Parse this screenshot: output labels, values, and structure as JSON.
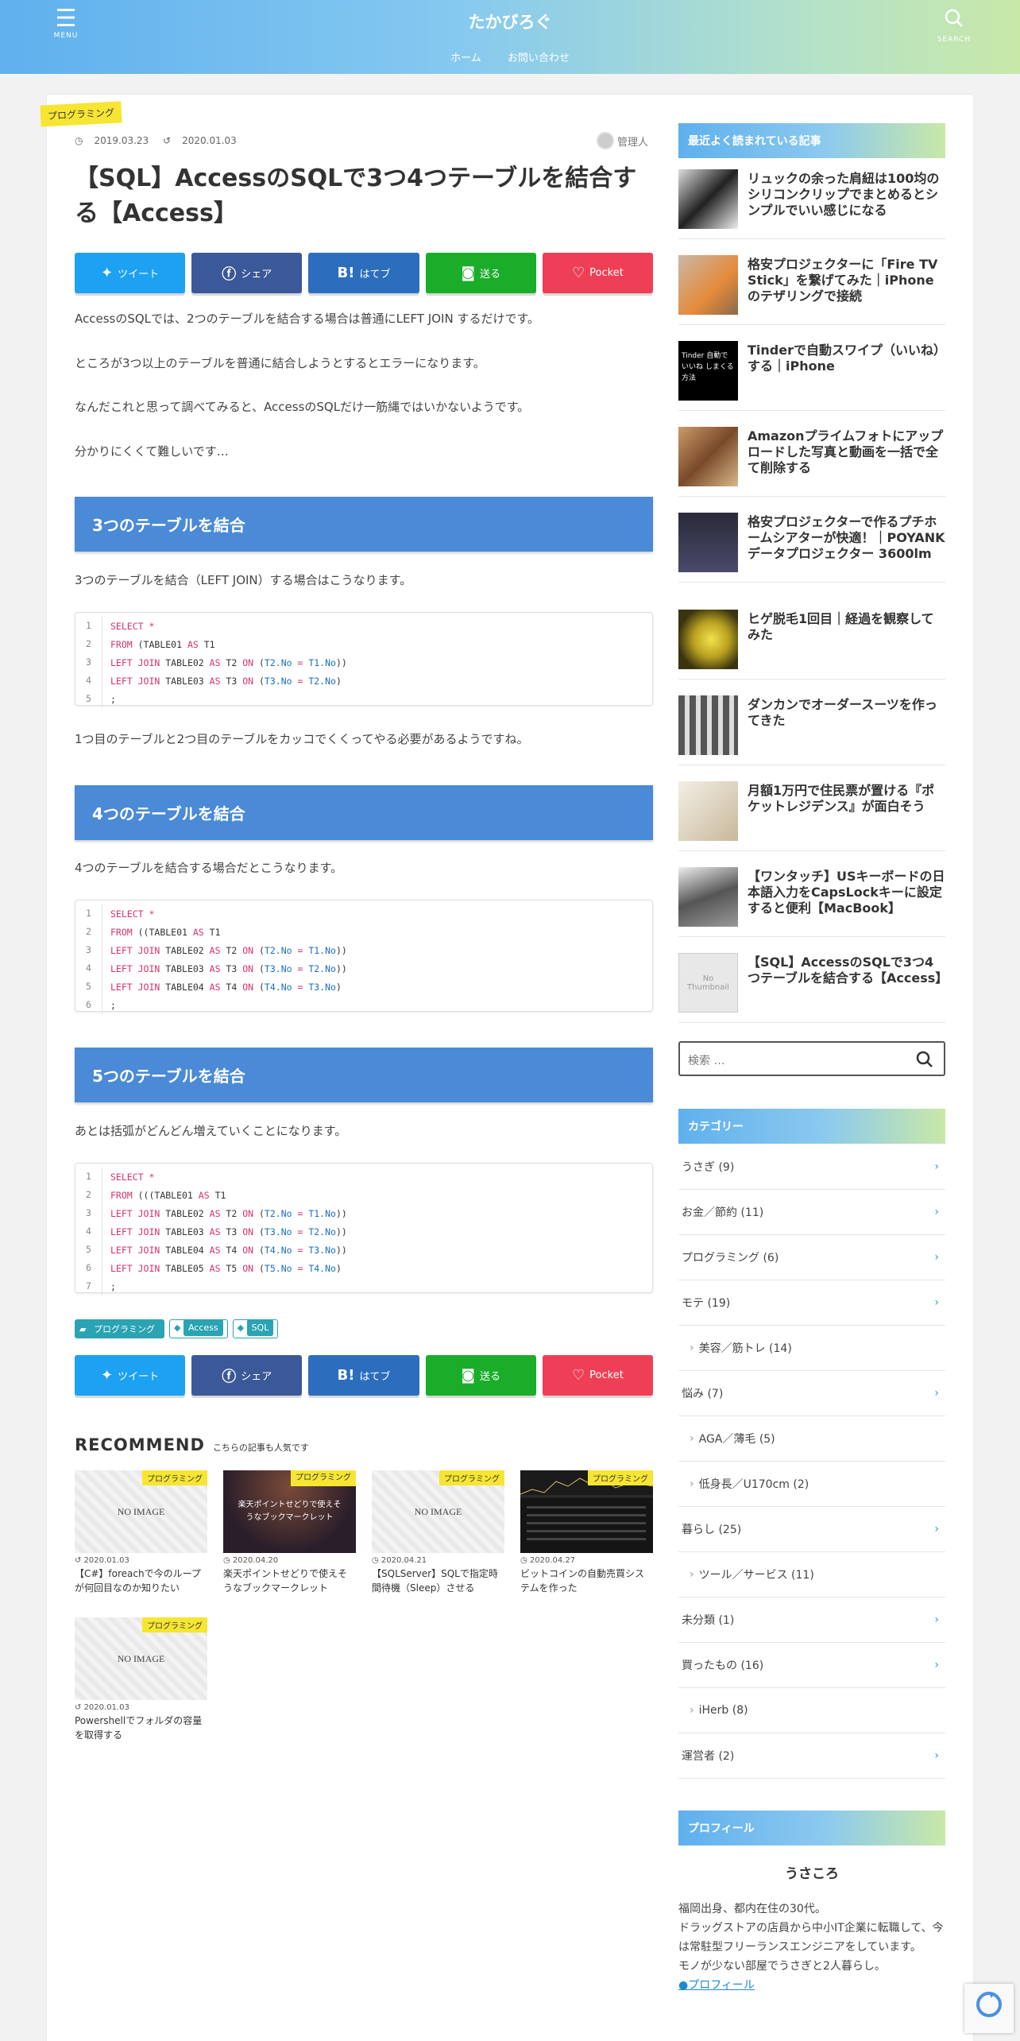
{
  "header": {
    "menu_label": "MENU",
    "search_label": "SEARCH",
    "site_title": "たかびろぐ",
    "nav": [
      "ホーム",
      "お問い合わせ"
    ]
  },
  "article": {
    "category": "プログラミング",
    "published": "2019.03.23",
    "updated": "2020.01.03",
    "author": "管理人",
    "title": "【SQL】AccessのSQLで3つ4つテーブルを結合する【Access】",
    "share": [
      "ツイート",
      "シェア",
      "はてブ",
      "送る",
      "Pocket"
    ],
    "intro": [
      "AccessのSQLでは、2つのテーブルを結合する場合は普通にLEFT JOIN するだけです。",
      "ところが3つ以上のテーブルを普通に結合しようとするとエラーになります。",
      "なんだこれと思って調べてみると、AccessのSQLだけ一筋縄ではいかないようです。",
      "分かりにくくて難しいです…"
    ],
    "sec1_title": "3つのテーブルを結合",
    "sec1_text": "3つのテーブルを結合（LEFT JOIN）する場合はこうなります。",
    "sec1_after": "1つ目のテーブルと2つ目のテーブルをカッコでくくってやる必要があるようですね。",
    "sec2_title": "4つのテーブルを結合",
    "sec2_text": "4つのテーブルを結合する場合だとこうなります。",
    "sec3_title": "5つのテーブルを結合",
    "sec3_text": "あとは括弧がどんどん増えていくことになります。",
    "tags": [
      "プログラミング",
      "Access",
      "SQL"
    ]
  },
  "recommend": {
    "title": "RECOMMEND",
    "sub": "こちらの記事も人気です",
    "no_image": "NO IMAGE",
    "thumb2_text": "楽天ポイントせどりで使えそうなブックマークレット",
    "items": [
      {
        "cat": "プログラミング",
        "date": "2020.01.03",
        "title": "【C#】foreachで今のループが何回目なのか知りたい"
      },
      {
        "cat": "プログラミング",
        "date": "2020.04.20",
        "title": "楽天ポイントせどりで使えそうなブックマークレット"
      },
      {
        "cat": "プログラミング",
        "date": "2020.04.21",
        "title": "【SQLServer】SQLで指定時間待機（Sleep）させる"
      },
      {
        "cat": "プログラミング",
        "date": "2020.04.27",
        "title": "ビットコインの自動売買システムを作った"
      },
      {
        "cat": "プログラミング",
        "date": "2020.01.03",
        "title": "Powershellでフォルダの容量を取得する"
      }
    ]
  },
  "sidebar": {
    "popular_title": "最近よく読まれている記事",
    "popular": [
      "リュックの余った肩紐は100均のシリコンクリップでまとめるとシンプルでいい感じになる",
      "格安プロジェクターに「Fire TV Stick」を繋げてみた｜iPhoneのテザリングで接続",
      "Tinderで自動スワイプ（いいね）する｜iPhone",
      "Amazonプライムフォトにアップロードした写真と動画を一括で全て削除する",
      "格安プロジェクターで作るプチホームシアターが快適！｜POYANK データプロジェクター 3600lm",
      "ヒゲ脱毛1回目｜経過を観察してみた",
      "ダンカンでオーダースーツを作ってきた",
      "月額1万円で住民票が置ける『ポケットレジデンス』が面白そう",
      "【ワンタッチ】USキーボードの日本語入力をCapsLockキーに設定すると便利【MacBook】",
      "【SQL】AccessのSQLで3つ4つテーブルを結合する【Access】"
    ],
    "no_thumb": "No Thumbnail",
    "tinder_text": "Tinder 自動でいいね しまくる方法",
    "search_placeholder": "検索 …",
    "category_title": "カテゴリー",
    "categories": [
      "うさぎ (9)",
      "お金／節約 (11)",
      "プログラミング (6)",
      "モテ (19)",
      "美容／筋トレ (14)",
      "悩み (7)",
      "AGA／薄毛 (5)",
      "低身長／U170cm (2)",
      "暮らし (25)",
      "ツール／サービス (11)",
      "未分類 (1)",
      "買ったもの (16)",
      "iHerb (8)",
      "運営者 (2)"
    ],
    "profile_title": "プロフィール",
    "profile_name": "うさころ",
    "profile_lines": [
      "福岡出身、都内在住の30代。",
      "ドラッグストアの店員から中小IT企業に転職して、今は常駐型フリーランスエンジニアをしています。",
      "モノが少ない部屋でうさぎと2人暮らし。"
    ],
    "profile_link": "●プロフィール"
  },
  "colors": {
    "h2": "#4a8ad6",
    "accent": "#2aa3b3",
    "tag": "#f7e533"
  }
}
